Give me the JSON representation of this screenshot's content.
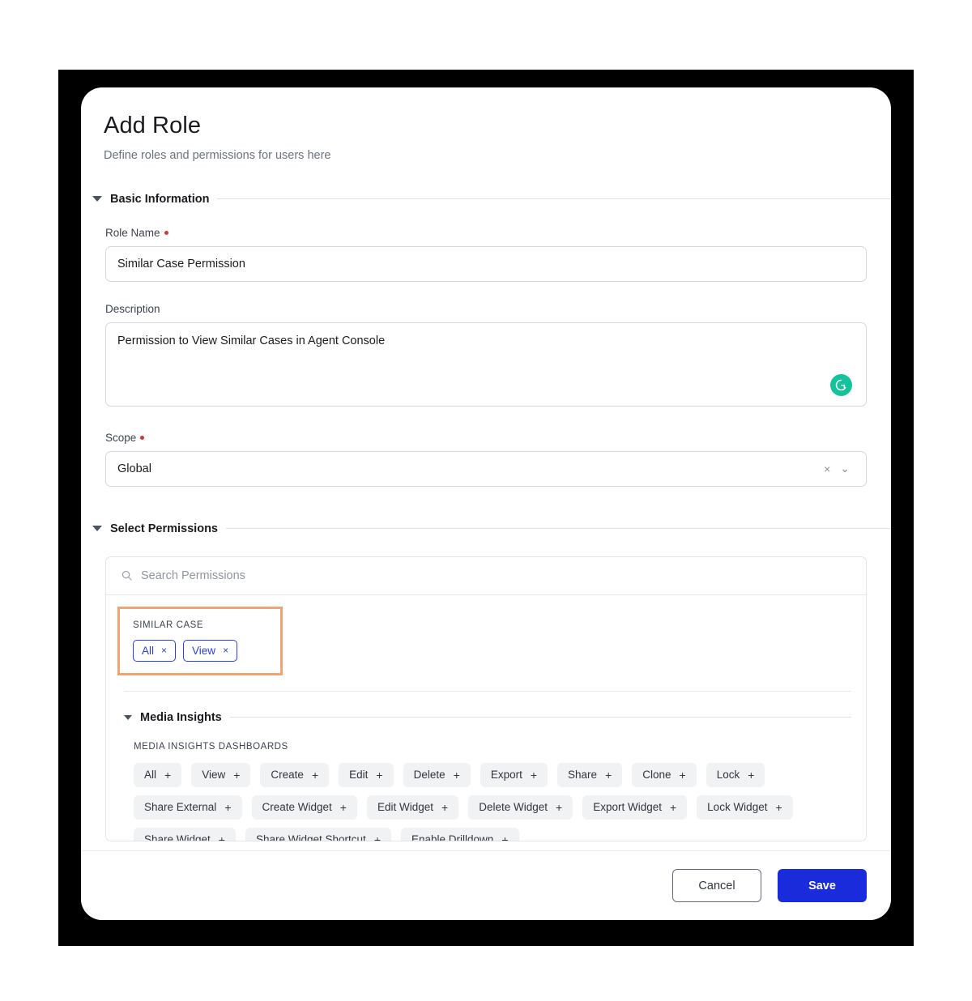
{
  "page": {
    "title": "Add Role",
    "subtitle": "Define roles and permissions for users here"
  },
  "sections": {
    "basic_information": "Basic Information",
    "select_permissions": "Select Permissions"
  },
  "fields": {
    "role_name": {
      "label": "Role Name",
      "value": "Similar Case Permission",
      "placeholder": "Role Name",
      "required": true
    },
    "description": {
      "label": "Description",
      "value": "Permission to View Similar Cases in Agent Console",
      "placeholder": "Description",
      "required": false,
      "assistant_icon": "grammarly-icon"
    },
    "scope": {
      "label": "Scope",
      "value": "Global",
      "required": true,
      "clear_icon": "×",
      "chevron_icon": "⌄"
    }
  },
  "permissions": {
    "search": {
      "placeholder": "Search Permissions",
      "value": "",
      "icon": "search-icon"
    },
    "highlighted_group": {
      "label": "SIMILAR CASE",
      "highlight_color": "#f0a373",
      "chips": [
        {
          "label": "All",
          "action": "×",
          "selected": true
        },
        {
          "label": "View",
          "action": "×",
          "selected": true
        }
      ]
    },
    "media_insights": {
      "title": "Media Insights",
      "group_label": "MEDIA INSIGHTS DASHBOARDS",
      "chips": [
        {
          "label": "All",
          "action": "+"
        },
        {
          "label": "View",
          "action": "+"
        },
        {
          "label": "Create",
          "action": "+"
        },
        {
          "label": "Edit",
          "action": "+"
        },
        {
          "label": "Delete",
          "action": "+"
        },
        {
          "label": "Export",
          "action": "+"
        },
        {
          "label": "Share",
          "action": "+"
        },
        {
          "label": "Clone",
          "action": "+"
        },
        {
          "label": "Lock",
          "action": "+"
        },
        {
          "label": "Share External",
          "action": "+"
        },
        {
          "label": "Create Widget",
          "action": "+"
        },
        {
          "label": "Edit Widget",
          "action": "+"
        },
        {
          "label": "Delete Widget",
          "action": "+"
        },
        {
          "label": "Export Widget",
          "action": "+"
        },
        {
          "label": "Lock Widget",
          "action": "+"
        },
        {
          "label": "Share Widget",
          "action": "+"
        },
        {
          "label": "Share Widget Shortcut",
          "action": "+"
        },
        {
          "label": "Enable Drilldown",
          "action": "+"
        }
      ]
    }
  },
  "footer": {
    "cancel_label": "Cancel",
    "save_label": "Save",
    "save_color": "#1a2bdb"
  }
}
